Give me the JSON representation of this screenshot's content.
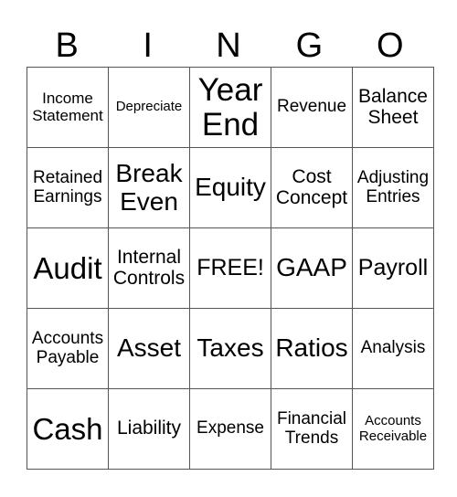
{
  "header": [
    "B",
    "I",
    "N",
    "G",
    "O"
  ],
  "rows": [
    [
      "Income Statement",
      "Depreciate",
      "Year End",
      "Revenue",
      "Balance Sheet"
    ],
    [
      "Retained Earnings",
      "Break Even",
      "Equity",
      "Cost Concept",
      "Adjusting Entries"
    ],
    [
      "Audit",
      "Internal Controls",
      "FREE!",
      "GAAP",
      "Payroll"
    ],
    [
      "Accounts Payable",
      "Asset",
      "Taxes",
      "Ratios",
      "Analysis"
    ],
    [
      "Cash",
      "Liability",
      "Expense",
      "Financial Trends",
      "Accounts Receivable"
    ]
  ]
}
